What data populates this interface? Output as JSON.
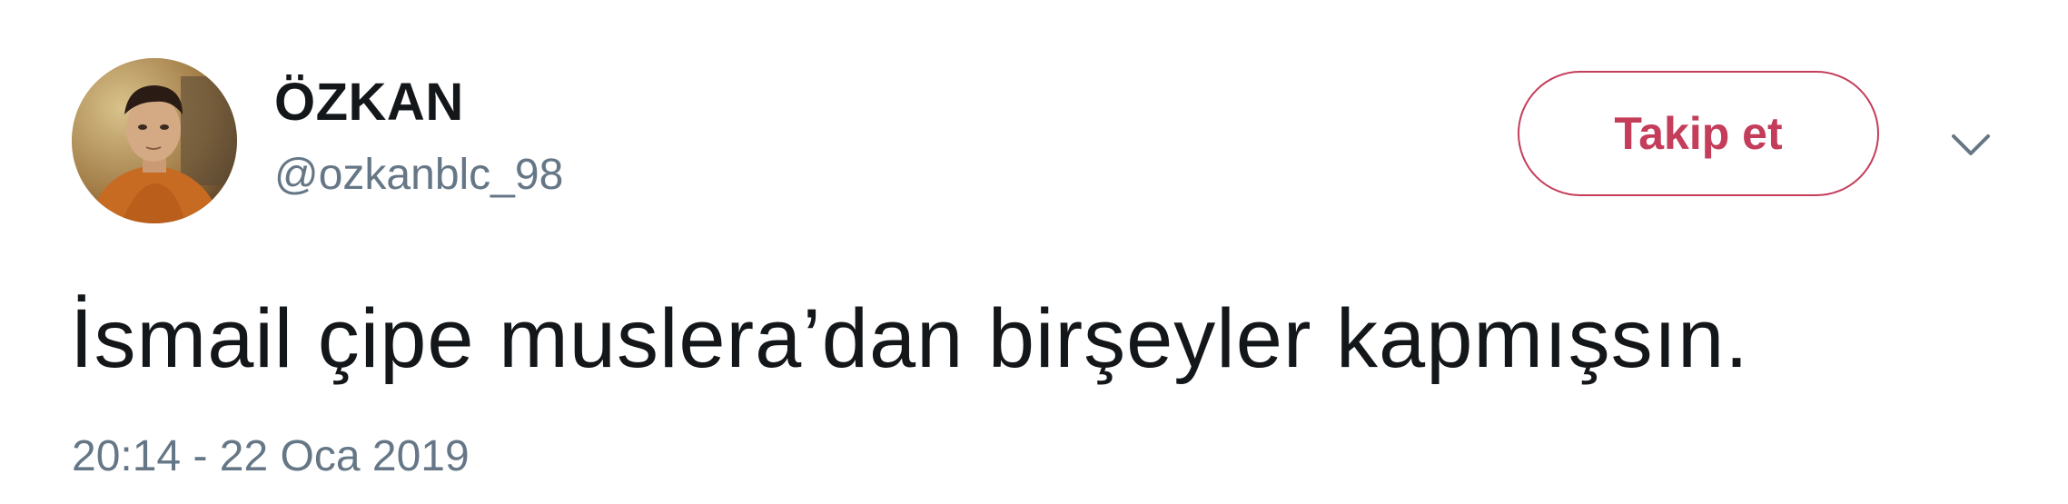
{
  "user": {
    "display_name": "ÖZKAN",
    "handle": "@ozkanblc_98"
  },
  "actions": {
    "follow_label": "Takip et",
    "more_icon": "chevron-down-icon"
  },
  "tweet": {
    "text": "İsmail çipe muslera’dan birşeyler kapmışsın.",
    "timestamp": "20:14 - 22 Oca 2019"
  },
  "colors": {
    "accent": "#c43d5b",
    "text_primary": "#14171a",
    "text_secondary": "#657786",
    "background": "#ffffff"
  }
}
